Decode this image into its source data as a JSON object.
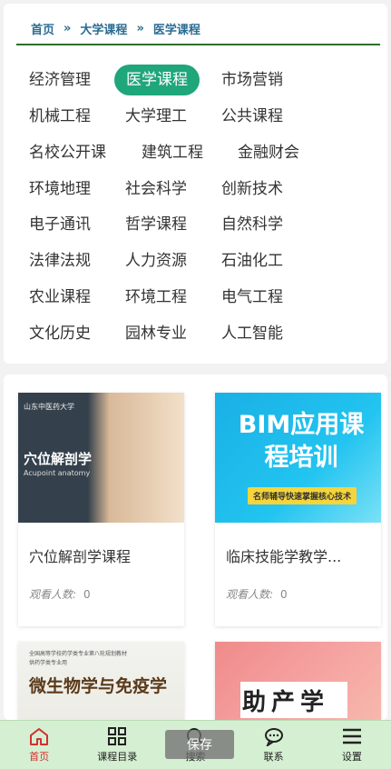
{
  "breadcrumb": {
    "home": "首页",
    "level1": "大学课程",
    "level2": "医学课程",
    "separator": "»"
  },
  "categories": [
    "经济管理",
    "医学课程",
    "市场营销",
    "机械工程",
    "大学理工",
    "公共课程",
    "名校公开课",
    "建筑工程",
    "金融财会",
    "环境地理",
    "社会科学",
    "创新技术",
    "电子通讯",
    "哲学课程",
    "自然科学",
    "法律法规",
    "人力资源",
    "石油化工",
    "农业课程",
    "环境工程",
    "电气工程",
    "文化历史",
    "园林专业",
    "人工智能"
  ],
  "courses": [
    {
      "title": "穴位解剖学课程",
      "views_label": "观看人数:",
      "views": "0",
      "thumb_text": "穴位解剖学",
      "thumb_sub": "Acupoint anatomy",
      "thumb_logo": "山东中医药大学"
    },
    {
      "title": "临床技能学教学...",
      "views_label": "观看人数:",
      "views": "0",
      "thumb_text": "BIM应用课程培训",
      "thumb_sub": "名师辅导快速掌握核心技术"
    },
    {
      "thumb_text": "微生物学与免疫学",
      "thumb_sub": "全国高等学校药学类专业第八轮规划教材",
      "thumb_sub2": "供药学类专业用"
    },
    {
      "thumb_text": "助产学"
    }
  ],
  "nav": [
    {
      "label": "首页",
      "icon": "home-icon"
    },
    {
      "label": "课程目录",
      "icon": "grid-icon"
    },
    {
      "label": "搜索",
      "icon": "search-icon"
    },
    {
      "label": "联系",
      "icon": "chat-icon"
    },
    {
      "label": "设置",
      "icon": "menu-icon"
    }
  ],
  "toast": "保存",
  "colors": {
    "active_category": "#1fa67a",
    "breadcrumb_text": "#2a6c92",
    "nav_bg": "#d5efd2",
    "nav_active": "#d23030"
  }
}
